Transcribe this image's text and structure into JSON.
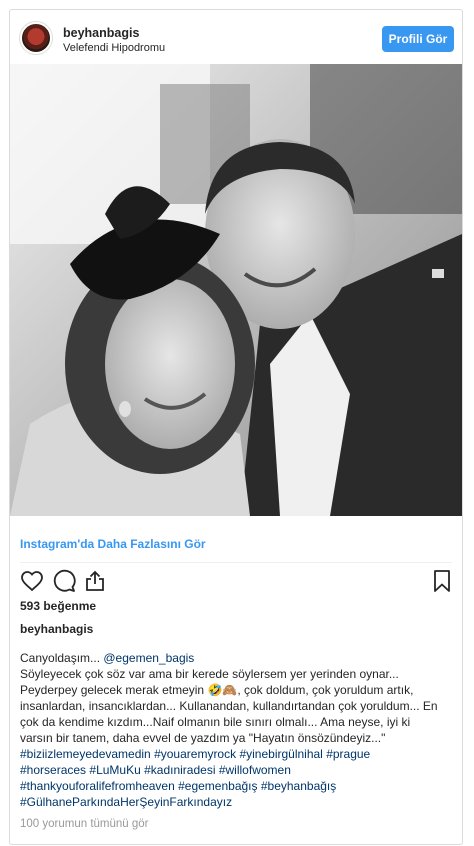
{
  "header": {
    "username": "beyhanbagis",
    "location": "Velefendi Hipodromu",
    "profile_button": "Profili Gör"
  },
  "more_link": "Instagram'da Daha Fazlasını Gör",
  "likes": "593 beğenme",
  "owner": "beyhanbagis",
  "caption": {
    "line1_text": "Canyoldaşım... ",
    "mention": "@egemen_bagis",
    "line2": "Söyleyecek çok söz var ama bir kerede söylersem yer yerinden oynar...",
    "line3_a": "Peyderpey gelecek merak etmeyin ",
    "emoji": "🤣🙈",
    "line3_b": ", çok doldum, çok yoruldum artık,",
    "line4": "insanlardan, insancıklardan... Kullanandan, kullandırtandan çok yoruldum... En",
    "line5": "çok da kendime kızdım...Naif olmanın bile sınırı olmalı... Ama neyse, iyi ki",
    "line6": "varsın bir tanem, daha evvel de yazdım ya \"Hayatın önsözündeyiz...\"",
    "line7": [
      "#biziizlemeyedevamedin",
      "#youaremyrock",
      "#yinebirgülnihal",
      "#prague"
    ],
    "line8": [
      "#horseraces",
      "#LuMuKu",
      "#kadıniradesi",
      "#willofwomen"
    ],
    "line9": [
      "#thankyouforalifefromheaven",
      "#egemenbağış",
      "#beyhanbağış"
    ],
    "line10": [
      "#GülhaneParkındaHerŞeyinFarkındayız"
    ]
  },
  "comments": "100 yorumun tümünü gör",
  "icons": {
    "like": "heart-icon",
    "comment": "comment-icon",
    "share": "share-icon",
    "save": "bookmark-icon"
  },
  "colors": {
    "accent": "#3897f0",
    "hashtag": "#003569",
    "muted": "#999999"
  }
}
